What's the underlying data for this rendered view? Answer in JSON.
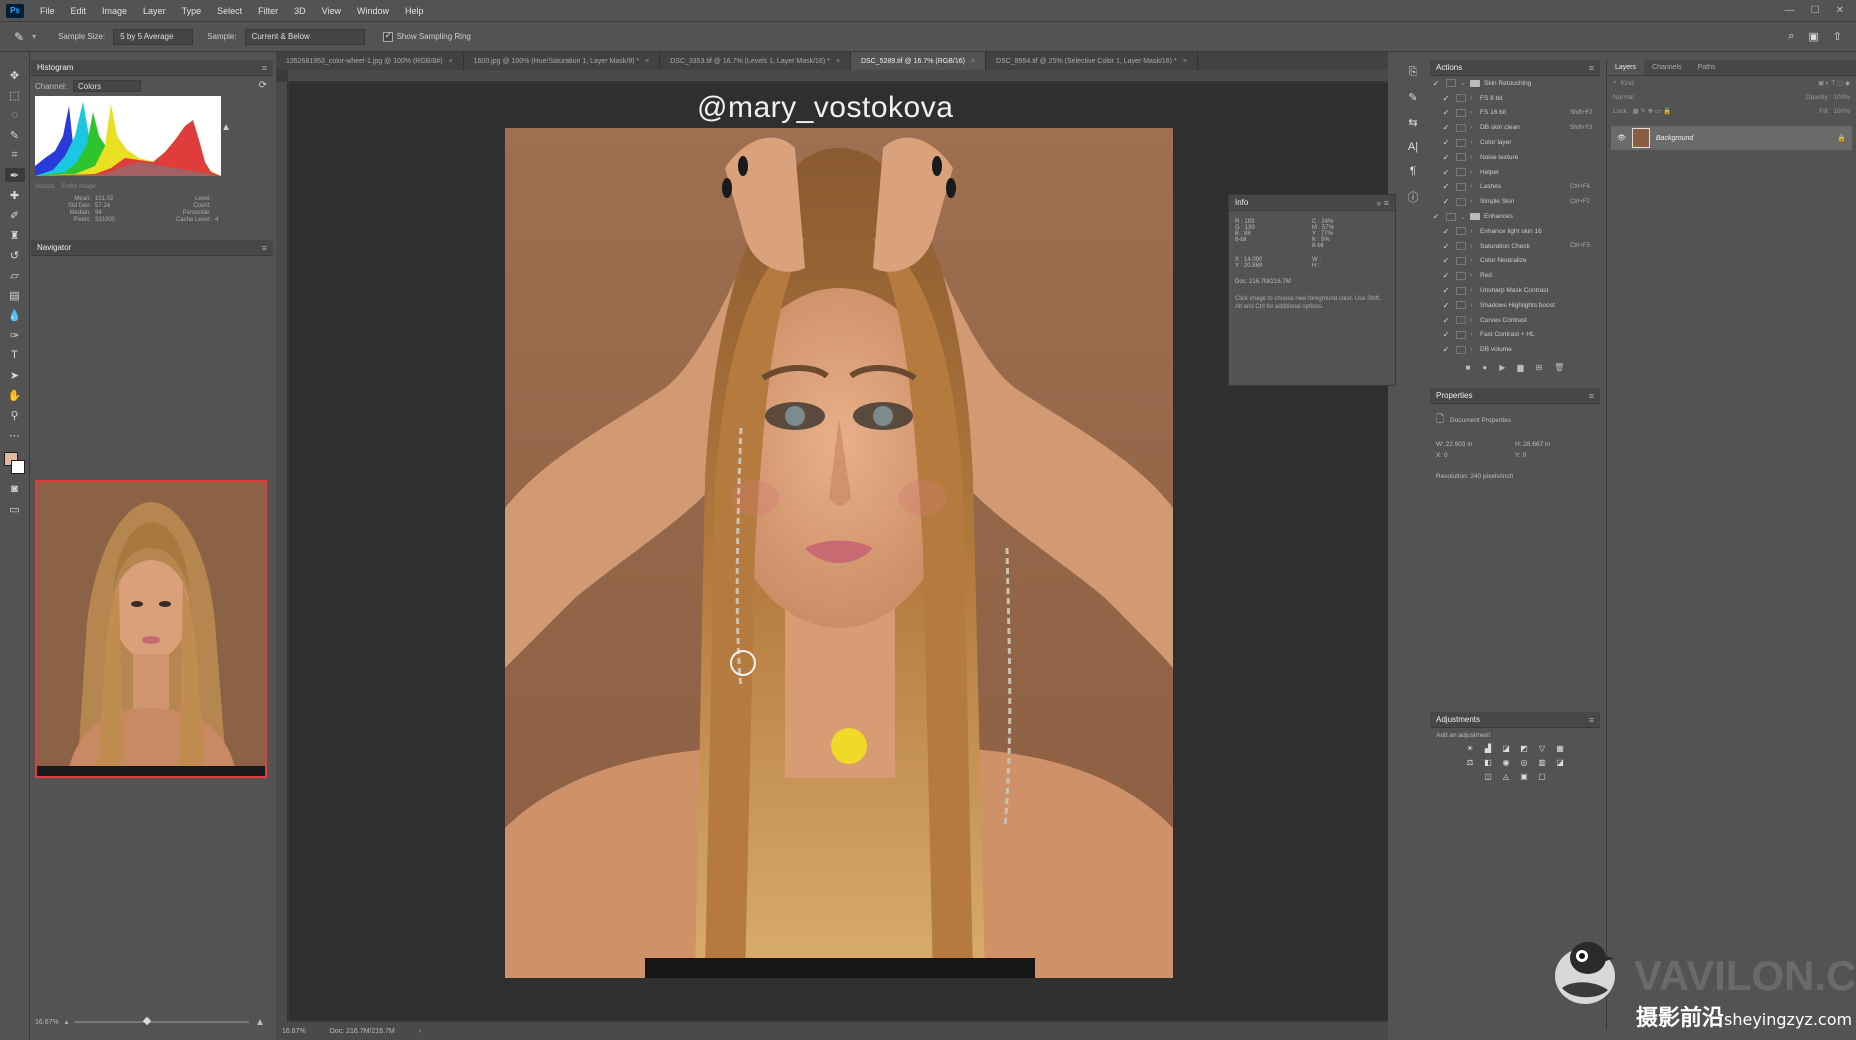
{
  "menubar": {
    "logo": "Ps",
    "items": [
      "File",
      "Edit",
      "Image",
      "Layer",
      "Type",
      "Select",
      "Filter",
      "3D",
      "View",
      "Window",
      "Help"
    ]
  },
  "options": {
    "sample_size_label": "Sample Size:",
    "sample_size_value": "5 by 5 Average",
    "sample_label": "Sample:",
    "sample_value": "Current & Below",
    "show_ring_label": "Show Sampling Ring"
  },
  "histogram": {
    "title": "Histogram",
    "channel_label": "Channel:",
    "channel_value": "Colors",
    "source_label": "Source:",
    "source_value": "Entire Image",
    "stats": [
      [
        "Mean:",
        "101.02",
        "Level:",
        ""
      ],
      [
        "Std Dev:",
        "57.24",
        "Count:",
        ""
      ],
      [
        "Median:",
        "94",
        "Percentile:",
        ""
      ],
      [
        "Pixels:",
        "331000",
        "Cache Level:",
        "4"
      ]
    ]
  },
  "navigator": {
    "title": "Navigator",
    "zoom": "16.67%"
  },
  "doc_tabs": [
    {
      "label": "1352681953_color-wheel-1.jpg @ 100% (RGB/8#)",
      "active": false
    },
    {
      "label": "1600.jpg @ 100% (Hue/Saturation 1, Layer Mask/8) *",
      "active": false
    },
    {
      "label": "DSC_3353.tif @ 16.7% (Levels 1, Layer Mask/16) *",
      "active": false
    },
    {
      "label": "DSC_5289.tif @ 16.7% (RGB/16)",
      "active": true
    },
    {
      "label": "DSC_8954.tif @ 25% (Selective Color 1, Layer Mask/16) *",
      "active": false
    }
  ],
  "canvas": {
    "watermark": "@mary_vostokova"
  },
  "statusbar": {
    "zoom": "16.67%",
    "doc": "Doc: 216.7M/216.7M"
  },
  "info": {
    "title": "Info",
    "rgb": [
      [
        "R :",
        "183"
      ],
      [
        "G :",
        "139"
      ],
      [
        "B :",
        "88"
      ]
    ],
    "cmyk": [
      [
        "C :",
        "24%"
      ],
      [
        "M :",
        "57%"
      ],
      [
        "Y :",
        "77%"
      ],
      [
        "K :",
        "5%"
      ]
    ],
    "bit_left": "8-bit",
    "bit_right": "8-bit",
    "xy": [
      [
        "X :",
        "14.090"
      ],
      [
        "Y :",
        "20.869"
      ]
    ],
    "wh": [
      [
        "W :",
        ""
      ],
      [
        "H :",
        ""
      ]
    ],
    "doc": "Doc: 216.7M/216.7M",
    "hint": "Click image to choose new foreground color. Use Shift, Alt and Ctrl for additional options."
  },
  "actions": {
    "title": "Actions",
    "rows": [
      {
        "name": "Skin Retouching",
        "folder": true,
        "key": ""
      },
      {
        "name": "FS 8 bit",
        "folder": false,
        "key": ""
      },
      {
        "name": "FS 16 bit",
        "folder": false,
        "key": "Shift+F2"
      },
      {
        "name": "DB skin clean",
        "folder": false,
        "key": "Shift+F3"
      },
      {
        "name": "Color layer",
        "folder": false,
        "key": ""
      },
      {
        "name": "Noise texture",
        "folder": false,
        "key": ""
      },
      {
        "name": "Helper",
        "folder": false,
        "key": ""
      },
      {
        "name": "Lashes",
        "folder": false,
        "key": "Ctrl+F4"
      },
      {
        "name": "Simple Skin",
        "folder": false,
        "key": "Ctrl+F2"
      },
      {
        "name": "Enhances",
        "folder": true,
        "key": ""
      },
      {
        "name": "Enhance light skin 16",
        "folder": false,
        "key": ""
      },
      {
        "name": "Saturation Check",
        "folder": false,
        "key": "Ctrl+F3"
      },
      {
        "name": "Color Neutralize",
        "folder": false,
        "key": ""
      },
      {
        "name": "Red",
        "folder": false,
        "key": ""
      },
      {
        "name": "Unsharp Mask Contrast",
        "folder": false,
        "key": ""
      },
      {
        "name": "Shadows Highlights boost",
        "folder": false,
        "key": ""
      },
      {
        "name": "Curves Contrast",
        "folder": false,
        "key": ""
      },
      {
        "name": "Fast Contrast + HL",
        "folder": false,
        "key": ""
      },
      {
        "name": "DB volume",
        "folder": false,
        "key": ""
      }
    ]
  },
  "properties": {
    "title": "Properties",
    "doc_label": "Document Properties",
    "w": "W: 22.903 in",
    "h": "H: 28.667 in",
    "x": "X: 0",
    "y": "Y: 0",
    "resolution": "Resolution: 240 pixels/inch"
  },
  "adjustments": {
    "title": "Adjustments",
    "add_label": "Add an adjustment"
  },
  "layers": {
    "tabs": [
      "Layers",
      "Channels",
      "Paths"
    ],
    "search_placeholder": "Kind",
    "blend": "Normal",
    "opacity_label": "Opacity:",
    "opacity_value": "100%",
    "lock_label": "Lock:",
    "fill_label": "Fill:",
    "fill_value": "100%",
    "layer_name": "Background"
  },
  "brand": {
    "logo_text": "VAVILON.CC",
    "cn_text": "摄影前沿",
    "cn_site": "sheyingzyz.com"
  },
  "colors": {
    "accent": "#e03c3c",
    "panel": "#535353",
    "canvas_bg": "#2f2f2f"
  }
}
